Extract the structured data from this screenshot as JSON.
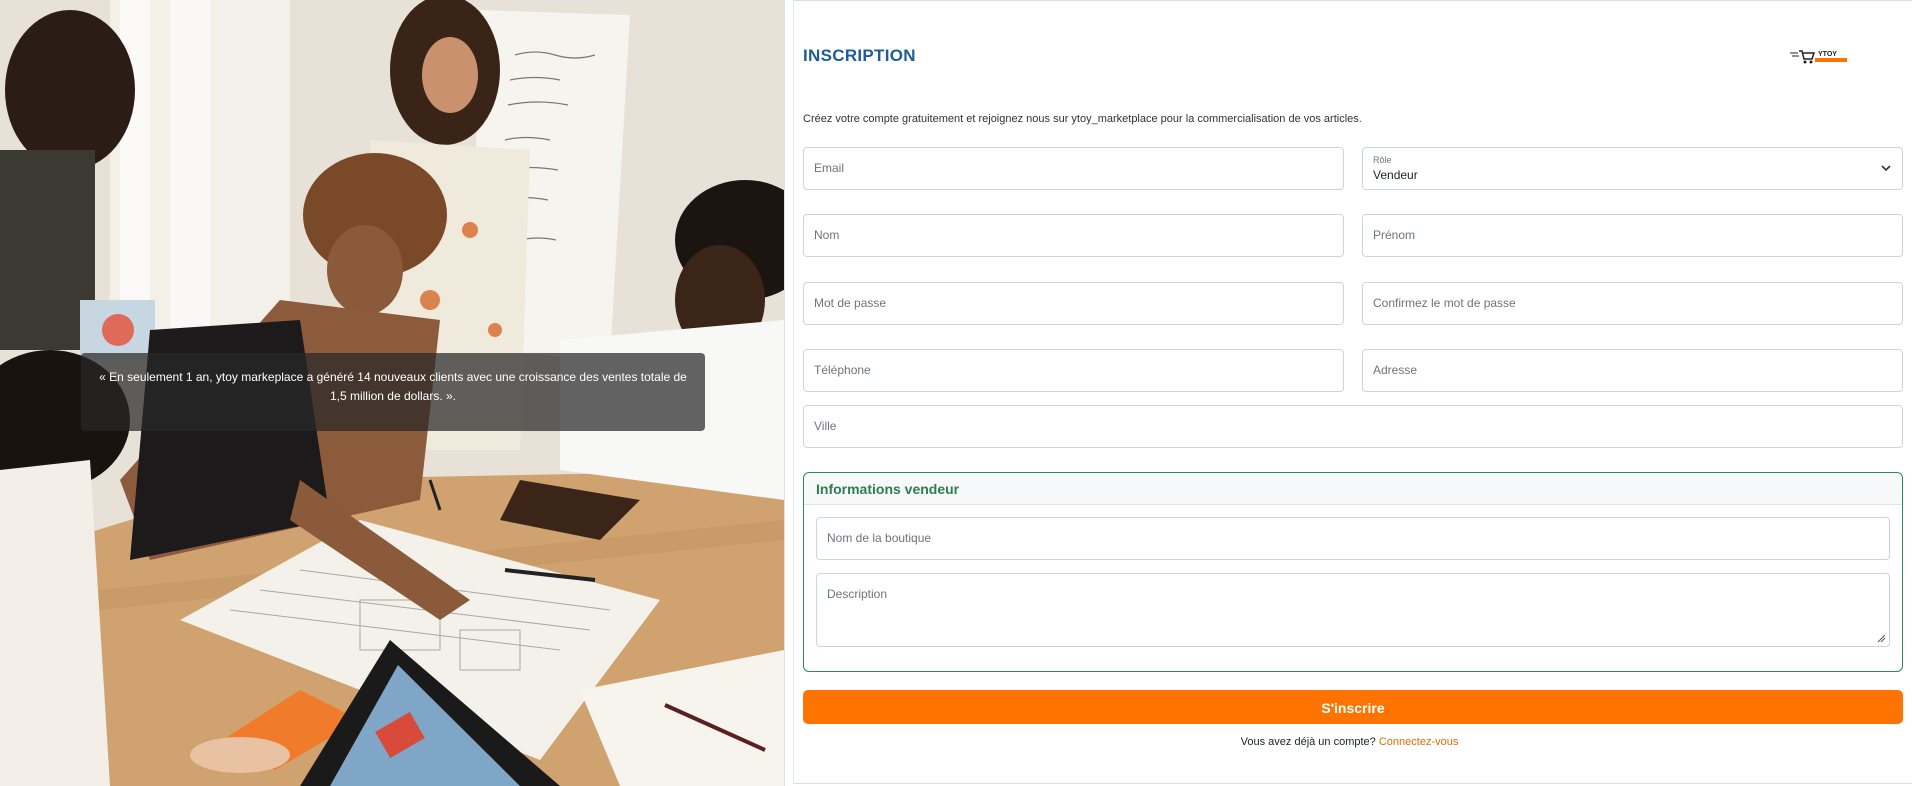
{
  "hero": {
    "quote": "« En seulement 1 an, ytoy markeplace a généré 14 nouveaux clients avec une croissance des ventes totale de 1,5 million de dollars. »."
  },
  "header": {
    "title": "INSCRIPTION",
    "logo_text": "YTOY",
    "intro": "Créez votre compte gratuitement et rejoignez nous sur ytoy_marketplace pour la commercialisation de vos articles."
  },
  "form": {
    "email_placeholder": "Email",
    "role_label": "Rôle",
    "role_value": "Vendeur",
    "nom_placeholder": "Nom",
    "prenom_placeholder": "Prénom",
    "password_placeholder": "Mot de passe",
    "confirm_password_placeholder": "Confirmez le mot de passe",
    "telephone_placeholder": "Téléphone",
    "adresse_placeholder": "Adresse",
    "ville_placeholder": "Ville"
  },
  "vendor": {
    "legend": "Informations vendeur",
    "shop_name_placeholder": "Nom de la boutique",
    "description_placeholder": "Description"
  },
  "actions": {
    "submit_label": "S'inscrire",
    "have_account": "Vous avez déjà un compte?",
    "login_link": "Connectez-vous"
  },
  "colors": {
    "title": "#1f5b99",
    "accent": "#ff7300",
    "vendor_green": "#2e8b57"
  }
}
